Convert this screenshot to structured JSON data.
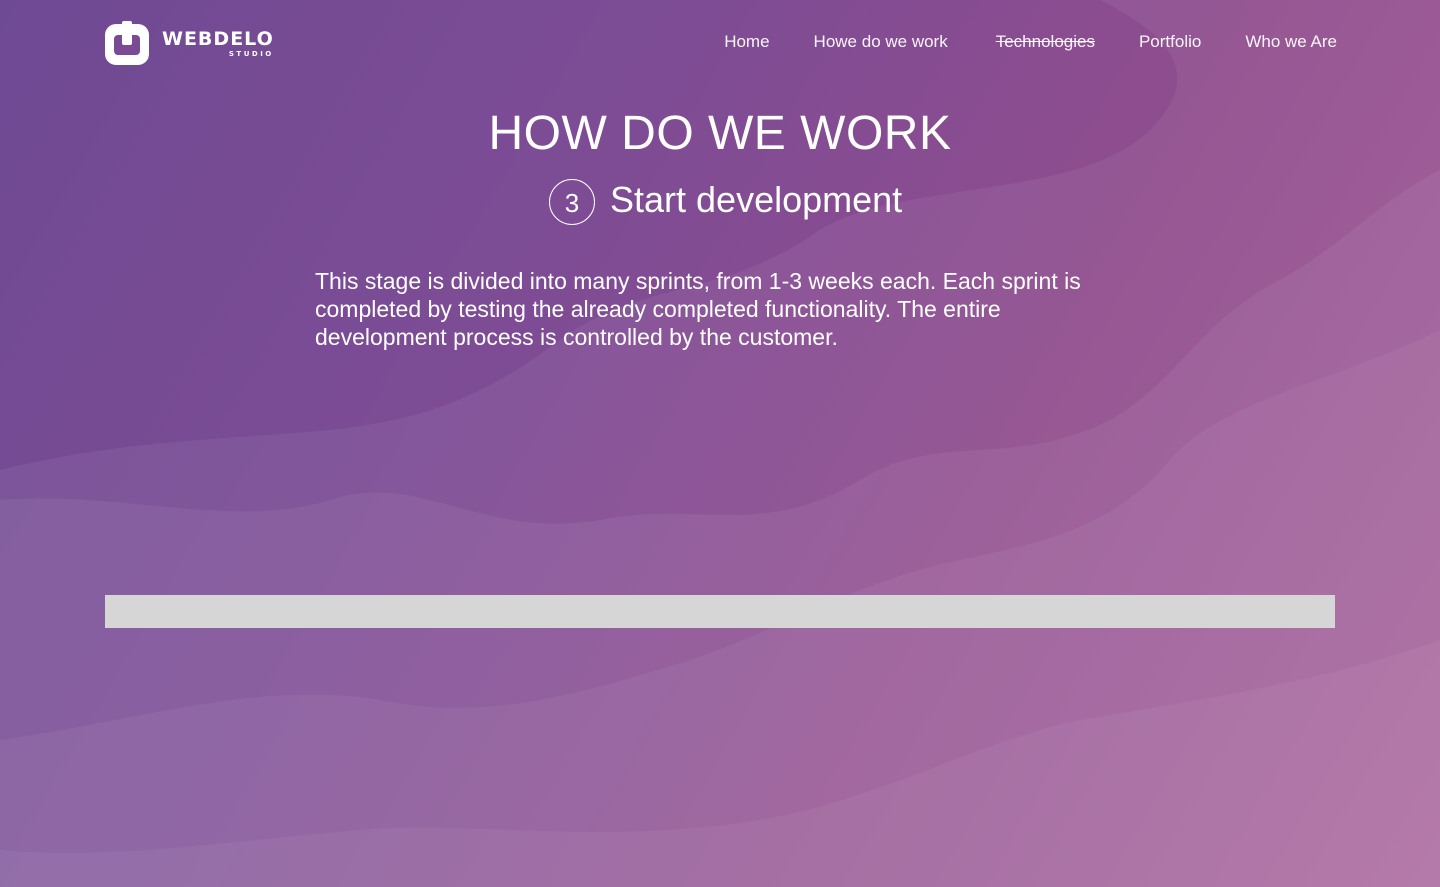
{
  "brand": {
    "name": "WEBDELO",
    "subtitle": "STUDIO"
  },
  "nav": {
    "items": [
      {
        "label": "Home"
      },
      {
        "label": "Howe do we work"
      },
      {
        "label": "Technologies"
      },
      {
        "label": "Portfolio"
      },
      {
        "label": "Who we Are"
      }
    ]
  },
  "main": {
    "title": "HOW DO WE WORK",
    "step_number": "3",
    "step_title": "Start development",
    "description": "This stage is divided into many sprints, from 1-3 weeks each. Each sprint is completed by testing the already completed functionality. The entire development process is controlled by the customer."
  },
  "colors": {
    "gradient_start": "#6f4a94",
    "gradient_end": "#a35a96",
    "bar": "#d6d6d6",
    "text": "#ffffff"
  },
  "icons": {
    "logo": "webdelo-logo-icon"
  }
}
